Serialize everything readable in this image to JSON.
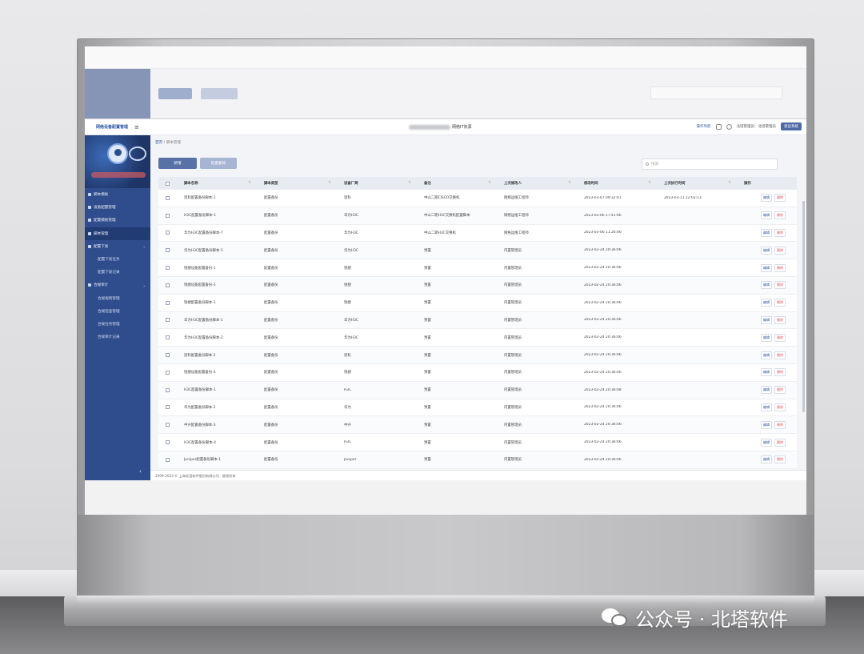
{
  "app": {
    "brand": "网络设备配置管理",
    "window_title": "网络IT资源",
    "menu_icon": "hamburger-icon"
  },
  "topbar": {
    "link": "操作导航",
    "user": "北塔管理员：北塔管理员",
    "exit_label": "退出系统"
  },
  "sidebar": {
    "items": [
      {
        "label": "脚本模板",
        "active": false,
        "sub": false
      },
      {
        "label": "设备配置管理",
        "active": false,
        "sub": false
      },
      {
        "label": "配置模板管理",
        "active": false,
        "sub": false
      },
      {
        "label": "脚本管理",
        "active": true,
        "sub": false
      },
      {
        "label": "配置下发",
        "active": false,
        "sub": false,
        "caret": "⌄"
      },
      {
        "label": "配置下发任务",
        "active": false,
        "sub": true
      },
      {
        "label": "配置下发记录",
        "active": false,
        "sub": true
      },
      {
        "label": "合规审计",
        "active": false,
        "sub": false,
        "caret": "⌄"
      },
      {
        "label": "合规规则管理",
        "active": false,
        "sub": true
      },
      {
        "label": "合规检查管理",
        "active": false,
        "sub": true
      },
      {
        "label": "合规任务管理",
        "active": false,
        "sub": true
      },
      {
        "label": "合规审计记录",
        "active": false,
        "sub": true
      }
    ],
    "collapse": "‹"
  },
  "breadcrumb": {
    "home": "首页",
    "sep": "/",
    "current": "脚本管理"
  },
  "toolbar": {
    "add": "新增",
    "batch": "批量删除",
    "search_placeholder": "搜索"
  },
  "table": {
    "headers": [
      "脚本名称",
      "脚本类型",
      "设备厂商",
      "备注",
      "上次修改人",
      "修改时间",
      "上次执行时间",
      "操作"
    ],
    "rows": [
      [
        "思科配置备份脚本-1",
        "配置备份",
        "思科",
        "中山二期CISCO交换机",
        "网络运维工程师",
        "2023-03-07 09:32:41",
        "2023-03-11 22:03:13"
      ],
      [
        "H3C配置备份脚本-1",
        "配置备份",
        "华为H3C",
        "中山二期H3C交换机配置脚本",
        "网络运维工程师",
        "2023-03-06 17:41:06",
        ""
      ],
      [
        "华为H3C配置备份脚本-7",
        "配置备份",
        "华为H3C",
        "中山二期H3C交换机",
        "网络运维工程师",
        "2023-03-06 11:26:06",
        ""
      ],
      [
        "华为H3C配置备份脚本-1",
        "配置备份",
        "华为H3C",
        "预置",
        "内置管理员",
        "2023-02-24 20:36:06",
        ""
      ],
      [
        "锐捷设备配置备份-1",
        "配置备份",
        "锐捷",
        "预置",
        "内置管理员",
        "2023-02-24 20:36:06",
        ""
      ],
      [
        "锐捷设备配置备份-3",
        "配置备份",
        "锐捷",
        "预置",
        "内置管理员",
        "2023-02-24 20:36:06",
        ""
      ],
      [
        "锐捷配置备份脚本-1",
        "配置备份",
        "锐捷",
        "预置",
        "内置管理员",
        "2023-02-24 20:36:06",
        ""
      ],
      [
        "华为H3C配置备份脚本-1",
        "配置备份",
        "华为H3C",
        "预置",
        "内置管理员",
        "2023-02-24 20:36:06",
        ""
      ],
      [
        "华为H3C配置备份脚本-2",
        "配置备份",
        "华为H3C",
        "预置",
        "内置管理员",
        "2023-02-24 20:36:06",
        ""
      ],
      [
        "思科配置备份脚本-2",
        "配置备份",
        "思科",
        "预置",
        "内置管理员",
        "2023-02-24 20:36:06",
        ""
      ],
      [
        "锐捷设备配置备份-4",
        "配置备份",
        "锐捷",
        "预置",
        "内置管理员",
        "2023-02-24 20:36:06",
        ""
      ],
      [
        "H3C配置备份脚本-1",
        "配置备份",
        "H3C",
        "预置",
        "内置管理员",
        "2023-02-24 20:36:08",
        ""
      ],
      [
        "华为配置备份脚本-2",
        "配置备份",
        "华为",
        "预置",
        "内置管理员",
        "2023-02-24 20:36:06",
        ""
      ],
      [
        "中兴配置备份脚本-3",
        "配置备份",
        "中兴",
        "预置",
        "内置管理员",
        "2023-02-24 20:36:06",
        ""
      ],
      [
        "H3C配置备份脚本-4",
        "配置备份",
        "H3C",
        "预置",
        "内置管理员",
        "2023-02-24 20:36:06",
        ""
      ],
      [
        "Juniper配置备份脚本-1",
        "配置备份",
        "Juniper",
        "预置",
        "内置管理员",
        "2023-02-24 20:36:06",
        ""
      ]
    ],
    "edit_label": "编辑",
    "delete_label": "删除"
  },
  "footer": {
    "text": "2009-2023 © 上海北塔软件股份有限公司 · 版权所有"
  },
  "watermark": {
    "text": "公众号 · 北塔软件",
    "icon": "wechat-icon"
  },
  "colors": {
    "sidebar": "#2f4d8c",
    "sidebar_active": "#213b73",
    "primary_button": "#5872a8",
    "link": "#2d55a4",
    "delete": "#e2525c"
  }
}
